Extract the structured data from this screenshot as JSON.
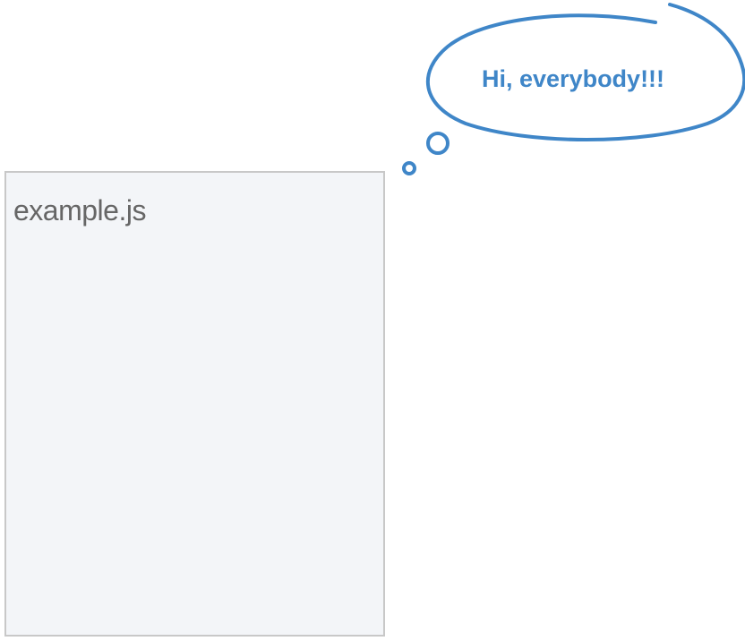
{
  "file_panel": {
    "title": "example.js"
  },
  "thought_bubble": {
    "text": "Hi, everybody!!!",
    "color": "#3f86c8"
  },
  "colors": {
    "panel_background": "#f3f5f8",
    "panel_border": "#c8c8c8",
    "panel_title": "#666666"
  }
}
